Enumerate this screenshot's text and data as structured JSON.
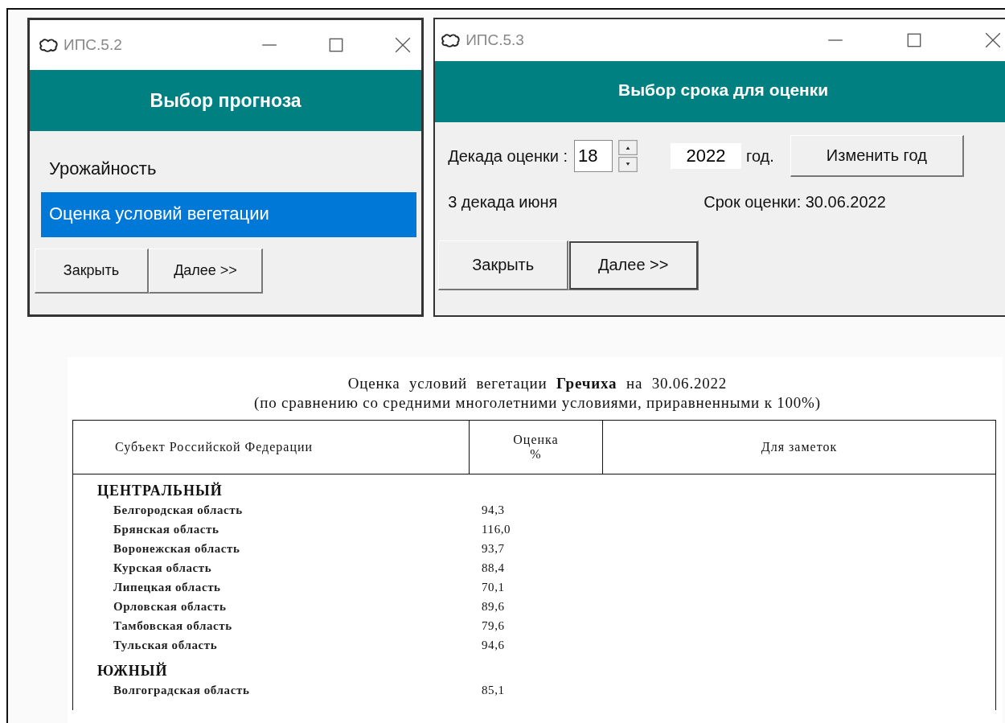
{
  "forecast_window": {
    "title": "ИПС.5.2",
    "header": "Выбор прогноза",
    "items": [
      {
        "label": "Урожайность",
        "selected": false
      },
      {
        "label": "Оценка условий вегетации",
        "selected": true
      }
    ],
    "buttons": [
      {
        "label": "Закрыть",
        "default": false
      },
      {
        "label": "Далее >>",
        "default": false
      }
    ]
  },
  "term_window": {
    "title": "ИПС.5.3",
    "header": "Выбор срока для оценки",
    "decade_label": "Декада оценки :",
    "decade_value": "18",
    "year_value": "2022",
    "year_suffix": "год.",
    "change_year_button": "Изменить год",
    "decade_text": "3 декада июня",
    "date_text": "Срок оценки: 30.06.2022",
    "buttons": [
      {
        "label": "Закрыть",
        "default": false
      },
      {
        "label": "Далее >>",
        "default": true
      }
    ]
  },
  "report": {
    "title": "Оценка условий вегетации **Гречиха** на 30.06.2022",
    "subtitle": "(по сравнению со средними многолетними условиями, приравненными к 100%)",
    "columns": [
      "Субъект Российской Федерации",
      "Оценка\n%",
      "Для заметок"
    ],
    "groups": [
      {
        "name": "ЦЕНТРАЛЬНЫЙ",
        "children": [
          {
            "name": "Белгородская область",
            "value": "94,3"
          },
          {
            "name": "Брянская область",
            "value": "116,0"
          },
          {
            "name": "Воронежская область",
            "value": "93,7"
          },
          {
            "name": "Курская область",
            "value": "88,4"
          },
          {
            "name": "Липецкая область",
            "value": "70,1"
          },
          {
            "name": "Орловская область",
            "value": "89,6"
          },
          {
            "name": "Тамбовская область",
            "value": "79,6"
          },
          {
            "name": "Тульская область",
            "value": "94,6"
          }
        ]
      },
      {
        "name": "ЮЖНЫЙ",
        "children": [
          {
            "name": "Волгоградская область",
            "value": "85,1"
          }
        ]
      }
    ]
  }
}
